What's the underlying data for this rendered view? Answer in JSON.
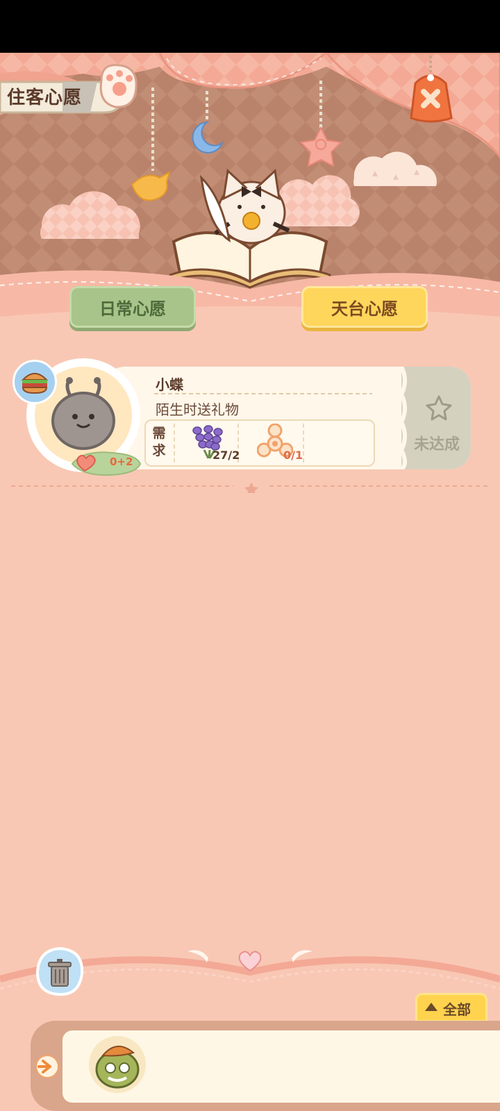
{
  "header": {
    "title": "住客心愿",
    "close_icon": "close-tag-icon"
  },
  "tabs": [
    {
      "label": "日常心愿",
      "active": false
    },
    {
      "label": "天台心愿",
      "active": true
    }
  ],
  "wish_card": {
    "guest_name": "小蝶",
    "description": "陌生时送礼物",
    "requirement_label": "需求",
    "requirements": [
      {
        "icon": "lavender-icon",
        "count": "27/2"
      },
      {
        "icon": "fidget-spinner-icon",
        "count": "0/1"
      }
    ],
    "heart_progress": "0+2",
    "status": "未达成",
    "badge_icon": "burger-icon"
  },
  "bottom": {
    "filter_label": "全部",
    "trash_icon": "trash-can-icon",
    "expand_icon": "expand-arrow-icon"
  },
  "colors": {
    "background": "#f8c8b4",
    "daily_tab": "#a9c48a",
    "rooftop_tab": "#ffd65c",
    "card": "#fff7ea",
    "status_unmet": "#d5d1bf"
  }
}
